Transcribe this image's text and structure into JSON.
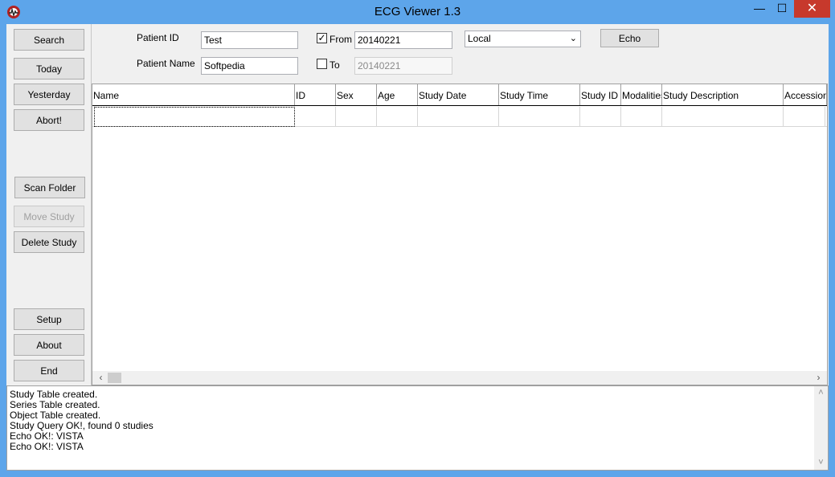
{
  "window": {
    "title": "ECG Viewer 1.3",
    "min_glyph": "—",
    "max_glyph": "☐",
    "close_glyph": "✕"
  },
  "sidebar": {
    "search": "Search",
    "today": "Today",
    "yesterday": "Yesterday",
    "abort": "Abort!",
    "scan_folder": "Scan Folder",
    "move_study": "Move Study",
    "delete_study": "Delete Study",
    "setup": "Setup",
    "about": "About",
    "end": "End"
  },
  "query": {
    "patient_id_label": "Patient ID",
    "patient_id_value": "Test",
    "patient_name_label": "Patient Name",
    "patient_name_value": "Softpedia",
    "from_checked": true,
    "from_label": "From",
    "from_value": "20140221",
    "to_checked": false,
    "to_label": "To",
    "to_value": "20140221",
    "location_value": "Local",
    "echo_label": "Echo"
  },
  "table": {
    "columns": [
      "Name",
      "ID",
      "Sex",
      "Age",
      "Study Date",
      "Study Time",
      "Study ID",
      "Modalities",
      "Study Description",
      "Accession"
    ]
  },
  "log": {
    "lines": [
      "Study Table created.",
      "Series Table created.",
      "Object Table created.",
      "Study Query OK!, found 0 studies",
      "Echo OK!: VISTA",
      "Echo OK!: VISTA"
    ]
  }
}
